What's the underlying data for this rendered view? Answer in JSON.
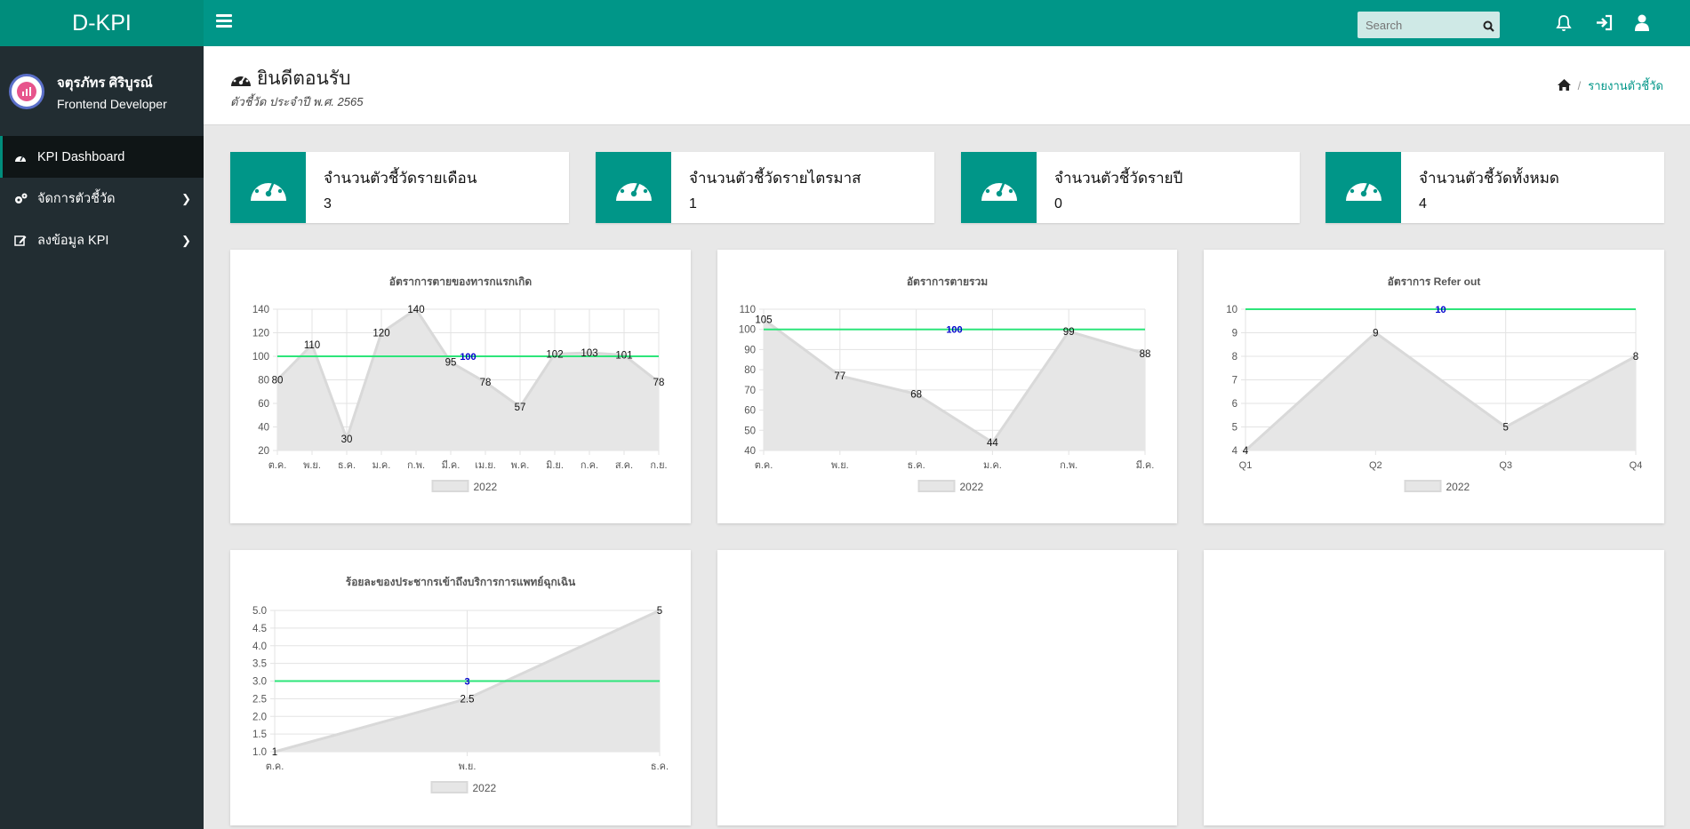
{
  "app": {
    "brand": "D-KPI"
  },
  "user": {
    "name": "จตุรภัทร ศิริบูรณ์",
    "role": "Frontend Developer"
  },
  "sidebar": {
    "items": [
      {
        "label": "KPI Dashboard",
        "icon": "dashboard-icon",
        "active": true
      },
      {
        "label": "จัดการตัวชี้วัด",
        "icon": "cogs-icon",
        "has_submenu": true
      },
      {
        "label": "ลงข้อมูล KPI",
        "icon": "edit-icon",
        "has_submenu": true
      }
    ]
  },
  "topbar": {
    "search_placeholder": "Search"
  },
  "header": {
    "title": "ยินดีตอนรับ",
    "subtitle": "ตัวชี้วัด ประจำปี พ.ศ. 2565",
    "breadcrumb": "รายงานตัวชี้วัด"
  },
  "stats": [
    {
      "label": "จำนวนตัวชี้วัดรายเดือน",
      "value": "3"
    },
    {
      "label": "จำนวนตัวชี้วัดรายไตรมาส",
      "value": "1"
    },
    {
      "label": "จำนวนตัวชี้วัดรายปี",
      "value": "0"
    },
    {
      "label": "จำนวนตัวชี้วัดทั้งหมด",
      "value": "4"
    }
  ],
  "colors": {
    "accent": "#009688",
    "sidebar": "#222d32",
    "target_line": "#2de57a",
    "target_label": "#0000cc",
    "area_fill": "#e6e6e6",
    "area_line": "#d9d9d9"
  },
  "chart_data": [
    {
      "type": "area",
      "title": "อัตราการตายของทารกแรกเกิด",
      "categories": [
        "ต.ค.",
        "พ.ย.",
        "ธ.ค.",
        "ม.ค.",
        "ก.พ.",
        "มี.ค.",
        "เม.ย.",
        "พ.ค.",
        "มิ.ย.",
        "ก.ค.",
        "ส.ค.",
        "ก.ย."
      ],
      "series": [
        {
          "name": "2022",
          "values": [
            80,
            110,
            30,
            120,
            140,
            95,
            78,
            57,
            102,
            103,
            101,
            78
          ]
        }
      ],
      "target": 100,
      "ylim": [
        20,
        140
      ],
      "yticks": [
        20,
        40,
        60,
        80,
        100,
        120,
        140
      ],
      "grid": true,
      "legend": "bottom"
    },
    {
      "type": "area",
      "title": "อัตราการตายรวม",
      "categories": [
        "ต.ค.",
        "พ.ย.",
        "ธ.ค.",
        "ม.ค.",
        "ก.พ.",
        "มี.ค."
      ],
      "series": [
        {
          "name": "2022",
          "values": [
            105,
            77,
            68,
            44,
            99,
            88
          ]
        }
      ],
      "target": 100,
      "ylim": [
        40,
        110
      ],
      "yticks": [
        40,
        50,
        60,
        70,
        80,
        90,
        100,
        110
      ],
      "grid": true,
      "legend": "bottom"
    },
    {
      "type": "area",
      "title": "อัตราการ Refer out",
      "categories": [
        "Q1",
        "Q2",
        "Q3",
        "Q4"
      ],
      "series": [
        {
          "name": "2022",
          "values": [
            4,
            9,
            5,
            8
          ]
        }
      ],
      "target": 10,
      "ylim": [
        4,
        10
      ],
      "yticks": [
        4,
        5,
        6,
        7,
        8,
        9,
        10
      ],
      "grid": true,
      "legend": "bottom"
    },
    {
      "type": "area",
      "title": "ร้อยละของประชากรเข้าถึงบริการการแพทย์ฉุกเฉิน",
      "categories": [
        "ต.ค.",
        "พ.ย.",
        "ธ.ค."
      ],
      "series": [
        {
          "name": "2022",
          "values": [
            1,
            2.5,
            5
          ]
        }
      ],
      "target": 3,
      "ylim": [
        1,
        5
      ],
      "yticks": [
        "1.0",
        "1.5",
        "2.0",
        "2.5",
        "3.0",
        "3.5",
        "4.0",
        "4.5",
        "5.0"
      ],
      "grid": true,
      "legend": "bottom"
    }
  ]
}
